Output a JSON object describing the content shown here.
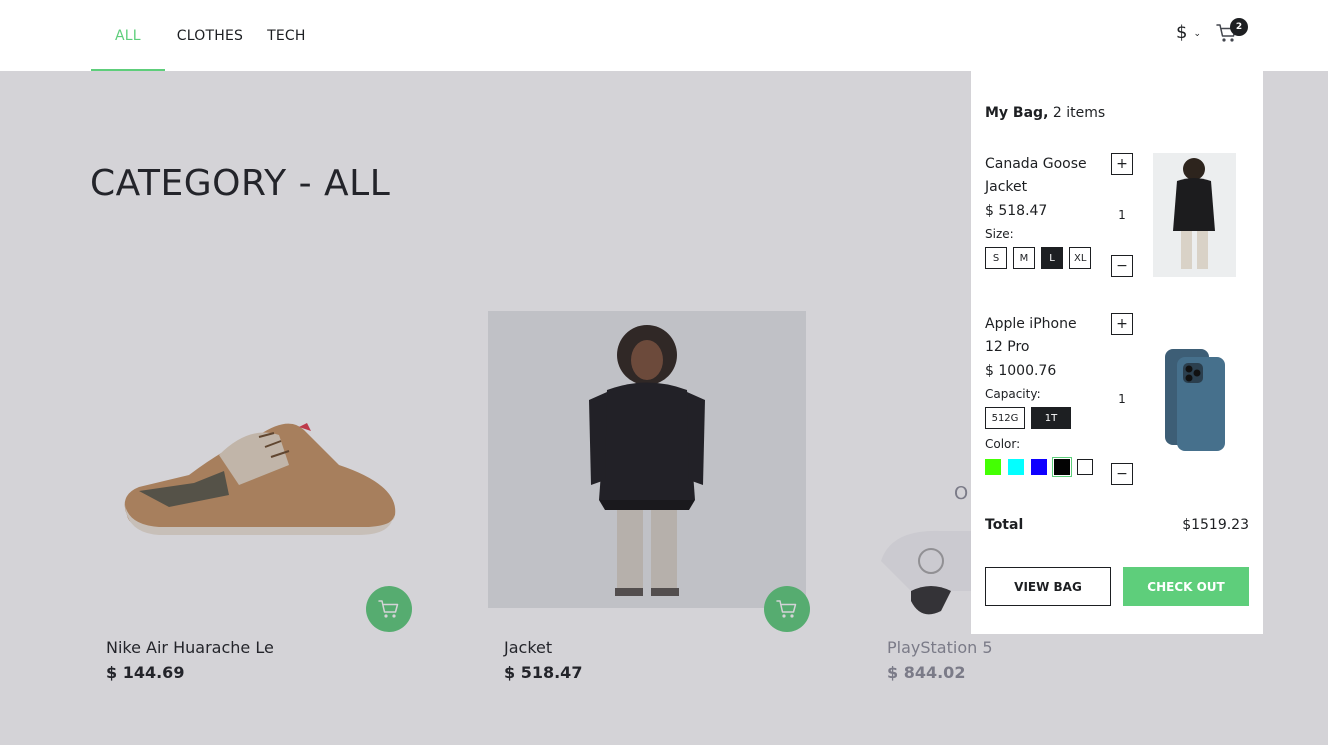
{
  "nav": {
    "tabs": [
      {
        "label": "ALL",
        "active": true
      },
      {
        "label": "CLOTHES",
        "active": false
      },
      {
        "label": "TECH",
        "active": false
      }
    ]
  },
  "header": {
    "currency_symbol": "$",
    "cart_count": "2",
    "icons": {
      "currency": "chevron-down-icon",
      "cart": "cart-icon"
    }
  },
  "category_title": "CATEGORY - ALL",
  "products": [
    {
      "name": "Nike Air Huarache Le",
      "price": "$ 144.69",
      "in_stock": true
    },
    {
      "name": "Jacket",
      "price": "$ 518.47",
      "in_stock": true
    },
    {
      "name": "PlayStation 5",
      "price": "$ 844.02",
      "in_stock": false,
      "overlay_text": "O"
    }
  ],
  "minicart": {
    "title": "My Bag,",
    "count_text": "2 items",
    "items": [
      {
        "name": "Canada Goose Jacket",
        "price": "$ 518.47",
        "quantity": "1",
        "attribute_label": "Size:",
        "options": [
          "S",
          "M",
          "L",
          "XL"
        ],
        "selected": "L"
      },
      {
        "name": "Apple iPhone 12 Pro",
        "price": "$ 1000.76",
        "quantity": "1",
        "attribute_label": "Capacity:",
        "options": [
          "512G",
          "1T"
        ],
        "selected": "1T",
        "color_label": "Color:",
        "colors": [
          "#44ff03",
          "#03ffff",
          "#0f00ff",
          "#030303",
          "#ffffff"
        ],
        "selected_color": "#030303"
      }
    ],
    "total_label": "Total",
    "total_value": "$1519.23",
    "view_bag_label": "VIEW BAG",
    "checkout_label": "CHECK OUT"
  },
  "colors": {
    "accent": "#5ece7b",
    "text": "#1d1f22",
    "overlay": "#393748"
  }
}
